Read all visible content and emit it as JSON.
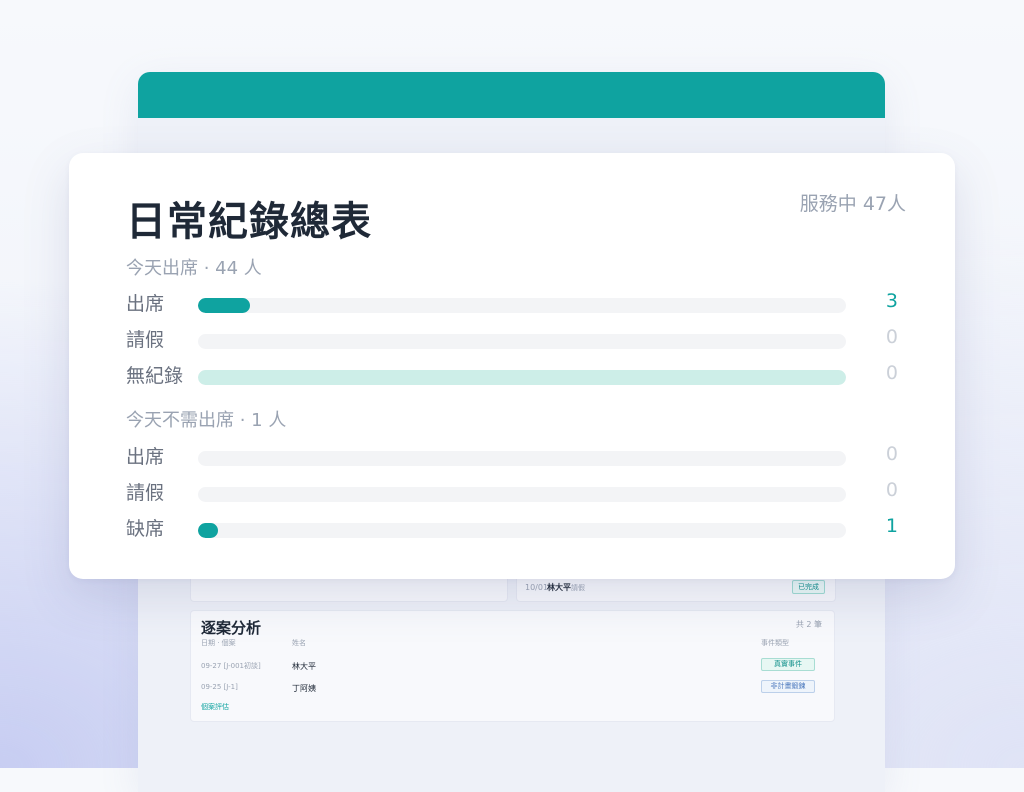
{
  "colors": {
    "accent": "#0fa3a0",
    "accent_light": "#cdeee8",
    "track": "#f3f4f6",
    "muted": "#cbd0d8"
  },
  "card": {
    "title": "日常紀錄總表",
    "service": "服務中 47人"
  },
  "sections": [
    {
      "label": "今天出席 · 44 人",
      "rows": [
        {
          "label": "出席",
          "value": "3",
          "fill_fraction": 0.08,
          "style": "accent"
        },
        {
          "label": "請假",
          "value": "0",
          "fill_fraction": 0,
          "style": "accent"
        },
        {
          "label": "無紀錄",
          "value": "0",
          "fill_fraction": 1.0,
          "style": "light"
        }
      ]
    },
    {
      "label": "今天不需出席 · 1 人",
      "rows": [
        {
          "label": "出席",
          "value": "0",
          "fill_fraction": 0,
          "style": "accent"
        },
        {
          "label": "請假",
          "value": "0",
          "fill_fraction": 0,
          "style": "accent"
        },
        {
          "label": "缺席",
          "value": "1",
          "fill_fraction": 0.03,
          "style": "accent"
        }
      ]
    }
  ],
  "background": {
    "log_row": {
      "date": "10/01",
      "name": "林大平",
      "tag": "請假",
      "status": "已完成"
    },
    "case_analysis": {
      "title": "逐案分析",
      "count": "共 2 筆",
      "headers": [
        "日期 · 個案",
        "姓名",
        "事件類型"
      ],
      "rows": [
        {
          "date": "09-27 [J-001初談]",
          "name": "林大平",
          "type": "真實事件",
          "kind": "real"
        },
        {
          "date": "09-25 [J-1]",
          "name": "丁阿姨",
          "type": "非計畫鍛鍊",
          "kind": "plan"
        }
      ],
      "link": "個案評估"
    }
  }
}
